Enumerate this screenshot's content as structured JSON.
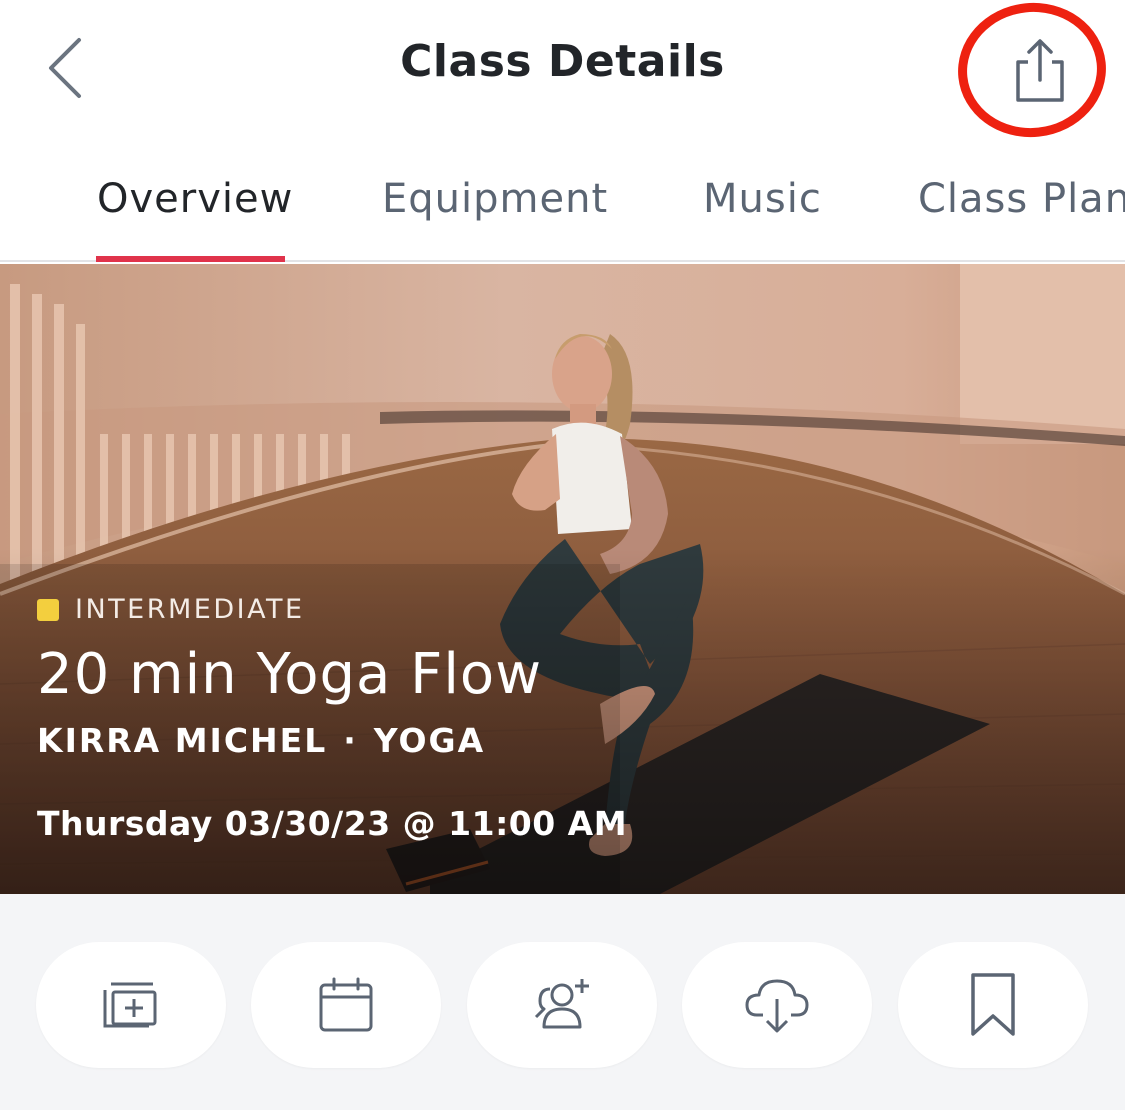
{
  "header": {
    "title": "Class Details",
    "back_icon": "chevron-left-icon",
    "share_icon": "share-icon"
  },
  "tabs": [
    {
      "label": "Overview",
      "active": true
    },
    {
      "label": "Equipment",
      "active": false
    },
    {
      "label": "Music",
      "active": false
    },
    {
      "label": "Class Plan",
      "active": false
    }
  ],
  "hero": {
    "level": "INTERMEDIATE",
    "title": "20 min Yoga Flow",
    "instructor": "KIRRA MICHEL",
    "separator": "·",
    "category": "YOGA",
    "schedule": "Thursday 03/30/23 @ 11:00 AM"
  },
  "actions": [
    {
      "icon": "add-to-stack-icon"
    },
    {
      "icon": "calendar-icon"
    },
    {
      "icon": "add-friend-icon"
    },
    {
      "icon": "cloud-download-icon"
    },
    {
      "icon": "bookmark-icon"
    }
  ],
  "colors": {
    "accent": "#e0334b",
    "highlight": "#ee2110",
    "level_intermediate": "#f3cf3e",
    "title_text": "#222529",
    "tab_inactive": "#5b6573"
  }
}
